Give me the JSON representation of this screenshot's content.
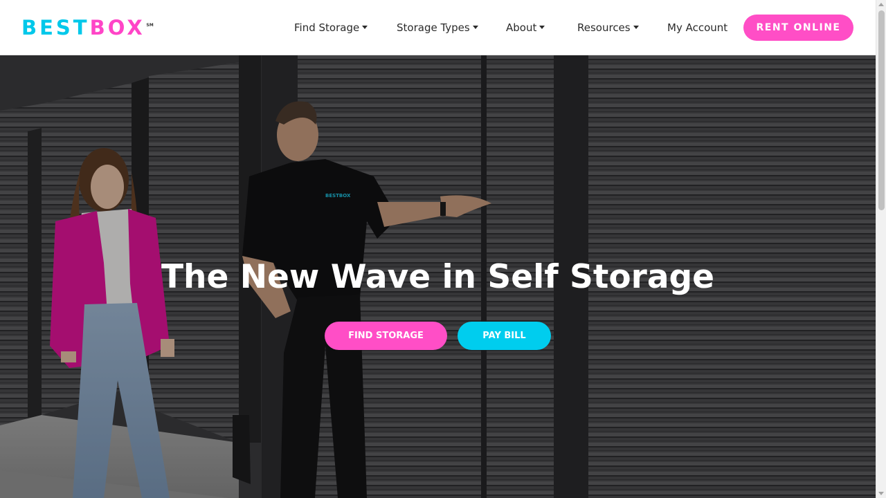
{
  "brand": {
    "name_part1": "BEST",
    "name_part2": "BOX",
    "mark": "SM",
    "colors": {
      "cyan": "#00c8ea",
      "pink": "#ff45c7"
    }
  },
  "nav": {
    "items": [
      {
        "label": "Find Storage",
        "has_dropdown": true
      },
      {
        "label": "Storage Types",
        "has_dropdown": true
      },
      {
        "label": "About",
        "has_dropdown": true
      },
      {
        "label": "Resources",
        "has_dropdown": true
      },
      {
        "label": "My Account",
        "has_dropdown": false
      }
    ],
    "cta_label": "RENT ONLINE"
  },
  "hero": {
    "title": "The New Wave in Self Storage",
    "primary_button": "FIND STORAGE",
    "secondary_button": "PAY BILL",
    "shirt_logo": "BESTBOX"
  },
  "icons": {
    "dropdown": "caret-down-icon",
    "scroll_up": "scroll-up-arrow-icon",
    "scroll_down": "scroll-down-arrow-icon"
  }
}
